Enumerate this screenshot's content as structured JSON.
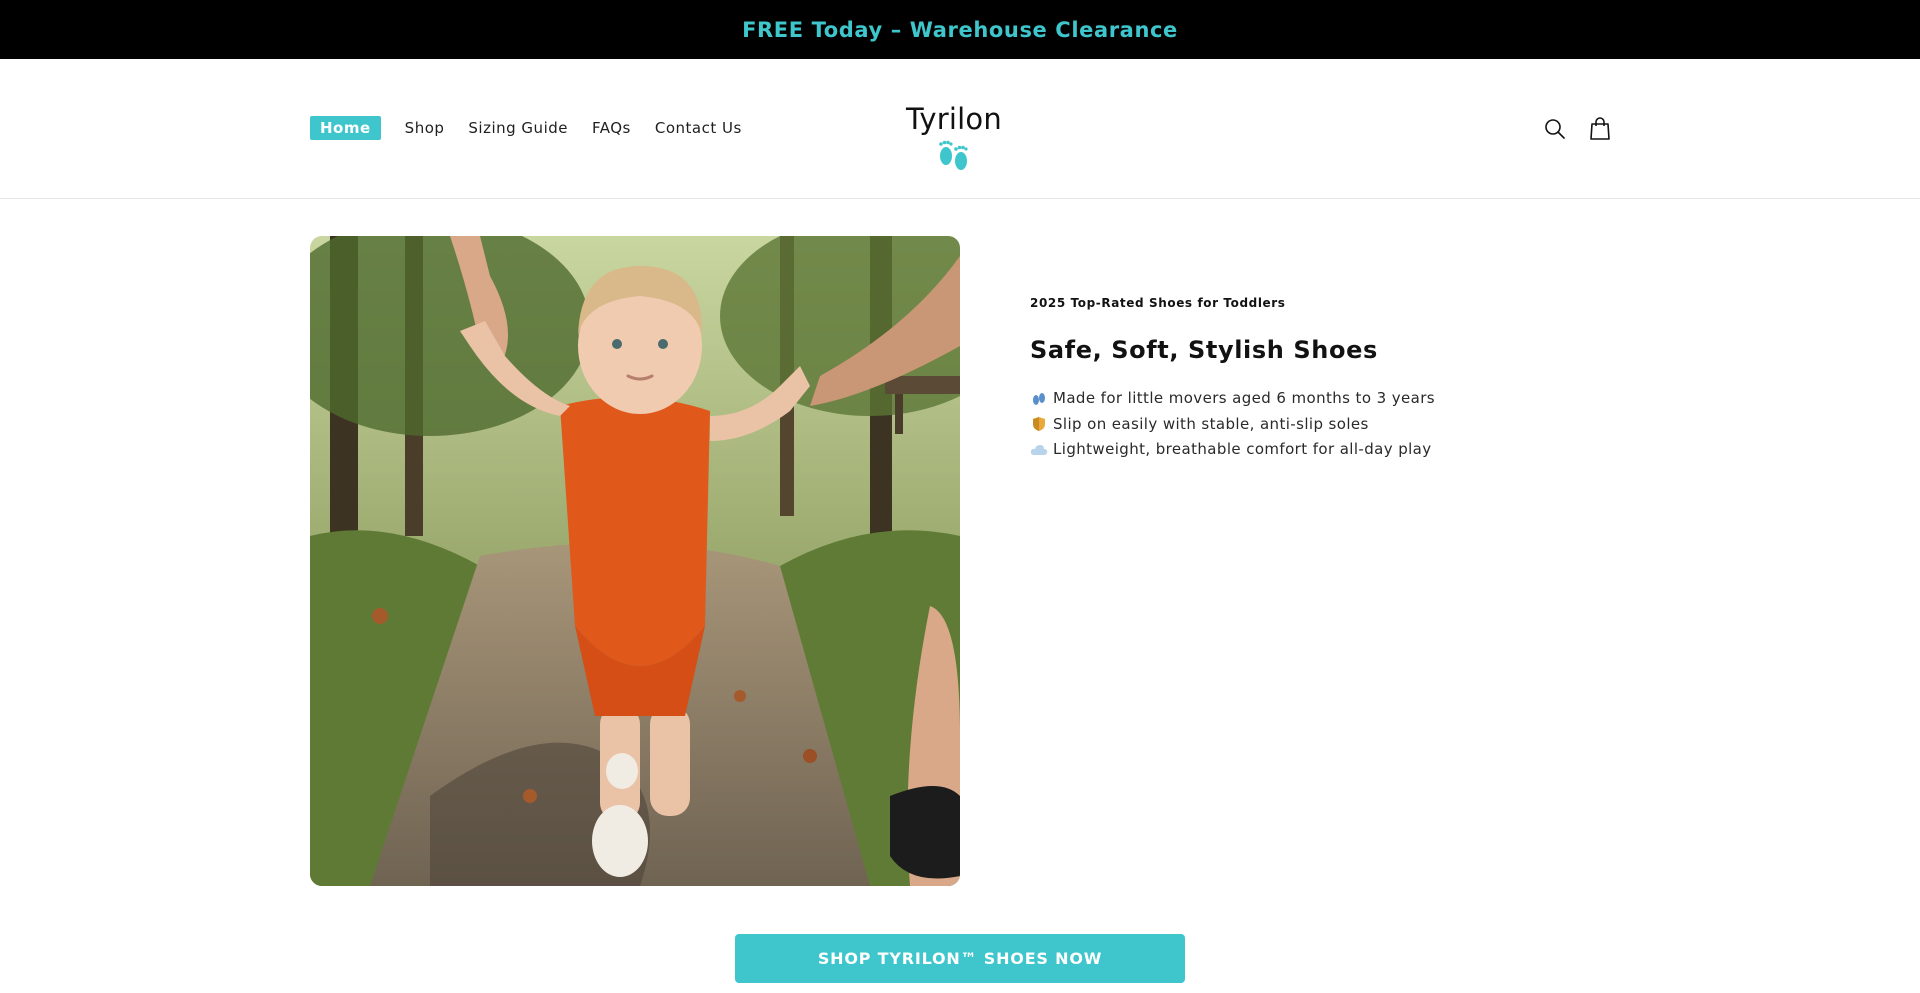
{
  "announcement": {
    "text": "FREE Today – Warehouse Clearance"
  },
  "header": {
    "nav": [
      {
        "label": "Home",
        "active": true
      },
      {
        "label": "Shop"
      },
      {
        "label": "Sizing Guide"
      },
      {
        "label": "FAQs"
      },
      {
        "label": "Contact Us"
      }
    ],
    "logo": {
      "text": "Tyrilon",
      "icon": "baby-feet-icon"
    },
    "icons": [
      "search-icon",
      "cart-bag-icon"
    ]
  },
  "hero": {
    "image": {
      "icon": "toddler-walking-photo"
    },
    "eyebrow": "2025 Top-Rated Shoes for Toddlers",
    "headline": "Safe, Soft, Stylish Shoes",
    "features": [
      {
        "icon": "footprints-icon",
        "text": "Made for little movers aged 6 months to 3 years"
      },
      {
        "icon": "shield-icon",
        "text": "Slip on easily with stable, anti-slip soles"
      },
      {
        "icon": "cloud-icon",
        "text": "Lightweight, breathable comfort for all-day play"
      }
    ]
  },
  "cta": {
    "label": "SHOP TYRILON™ SHOES NOW"
  },
  "colors": {
    "accent": "#3ec6cc",
    "announcement_bg": "#000000",
    "text": "#121212"
  }
}
